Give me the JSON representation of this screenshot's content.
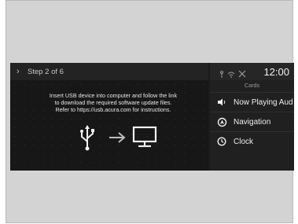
{
  "step": {
    "label": "Step 2 of 6"
  },
  "instructions": {
    "lines": [
      "Insert USB device into computer and follow the link",
      "to download the required software update files.",
      "Refer to https://usb.acura.com for instructions."
    ]
  },
  "graphic": {
    "usb_icon": "usb-icon",
    "arrow_icon": "arrow-right-icon",
    "monitor_icon": "monitor-icon"
  },
  "status": {
    "icons": [
      "antenna-icon",
      "wifi-icon",
      "tools-icon"
    ],
    "time": "12:00"
  },
  "cards": {
    "title": "Cards",
    "items": [
      {
        "label": "Now Playing Aud",
        "icon": "speaker-icon"
      },
      {
        "label": "Navigation",
        "icon": "navigation-icon"
      },
      {
        "label": "Clock",
        "icon": "clock-icon"
      }
    ]
  },
  "colors": {
    "screen_bg": "#171717",
    "sidebar_bg": "#202020",
    "frame_bg": "#d3d3d3",
    "text": "#eeeeee"
  }
}
